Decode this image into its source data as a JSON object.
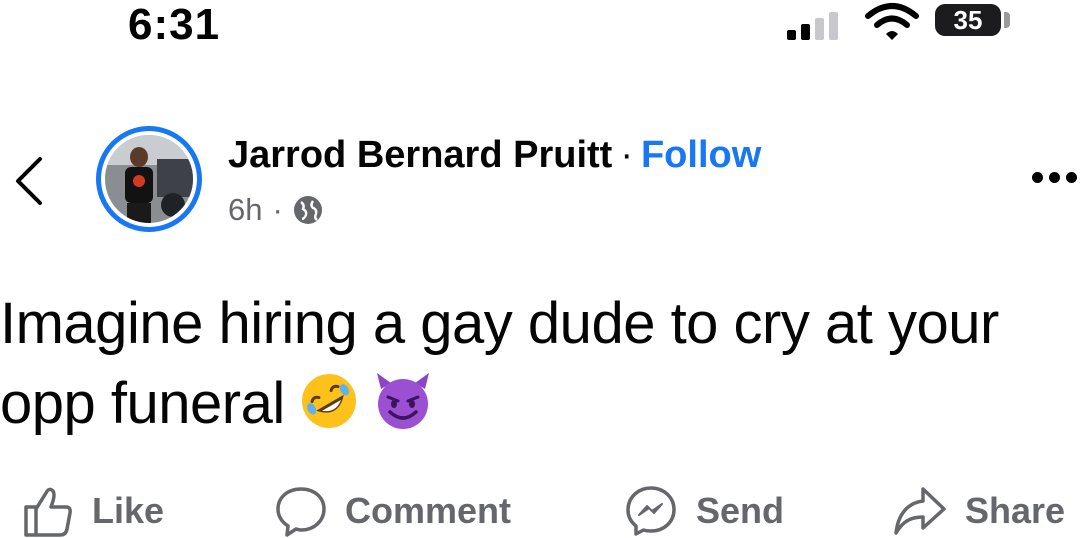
{
  "status_bar": {
    "time": "6:31",
    "battery_level": "35",
    "icons": [
      "cellular-signal-icon",
      "wifi-icon",
      "battery-icon"
    ]
  },
  "post": {
    "author": "Jarrod Bernard Pruitt",
    "separator": "·",
    "follow_label": "Follow",
    "time_ago": "6h",
    "meta_separator": "·",
    "audience_icon": "globe-icon",
    "text_line1": "Imagine hiring a gay dude to cry at your",
    "text_line2": "opp funeral",
    "emojis": [
      "rolling-on-floor-laughing-emoji",
      "smiling-devil-emoji"
    ]
  },
  "actions": {
    "like": "Like",
    "comment": "Comment",
    "send": "Send",
    "share": "Share"
  },
  "colors": {
    "accent": "#1877f2",
    "secondary_text": "#65676b",
    "primary_text": "#050505"
  }
}
